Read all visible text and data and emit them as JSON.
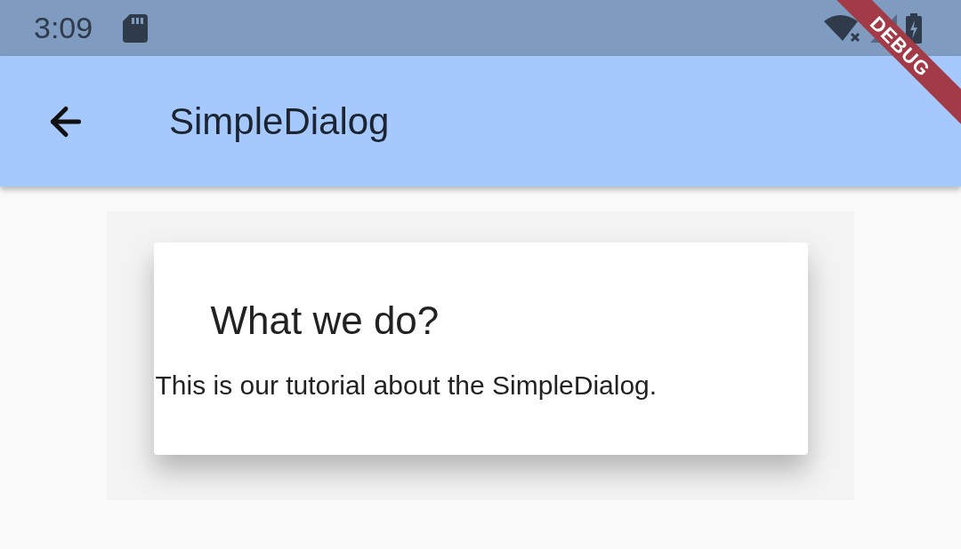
{
  "status_bar": {
    "time": "3:09"
  },
  "app_bar": {
    "title": "SimpleDialog"
  },
  "dialog": {
    "title": "What we do?",
    "text": "This is our tutorial about the SimpleDialog."
  },
  "debug_banner": {
    "label": "DEBUG"
  }
}
